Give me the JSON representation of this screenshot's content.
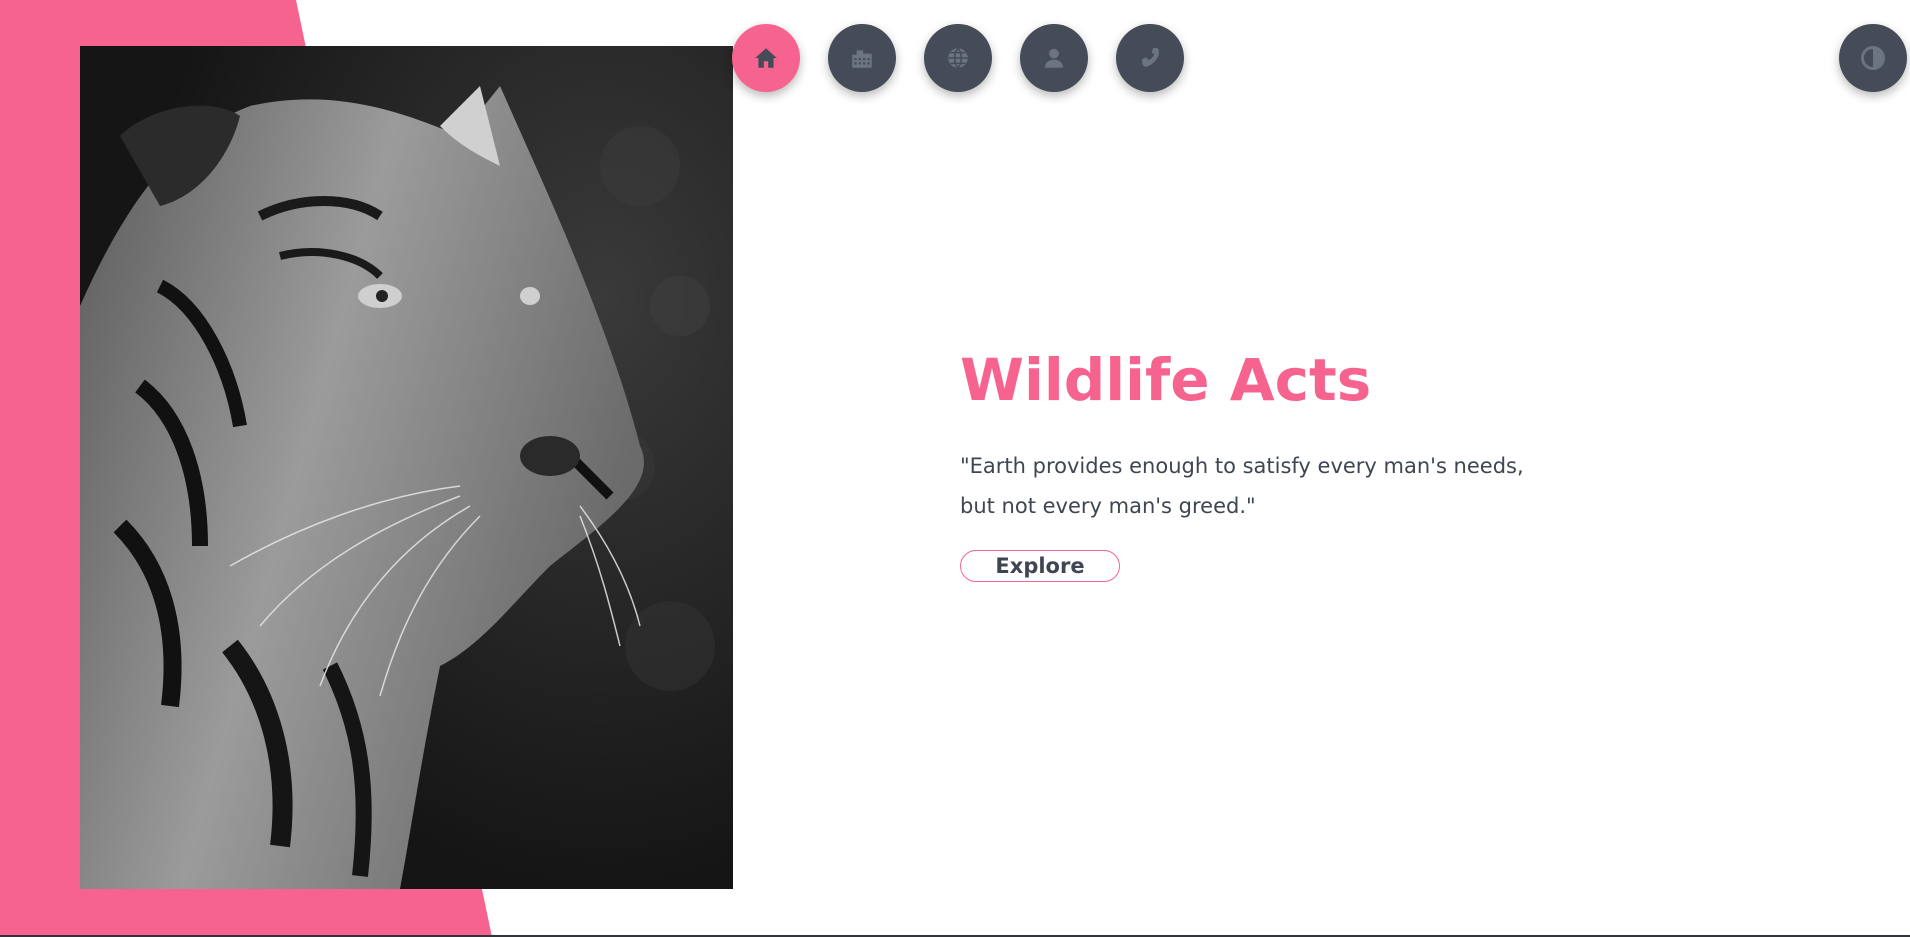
{
  "colors": {
    "accent": "#f7638f",
    "dark": "#454c57",
    "text": "#3f4652",
    "background": "#ffffff"
  },
  "nav": {
    "items": [
      {
        "icon": "home-icon",
        "active": true
      },
      {
        "icon": "building-icon",
        "active": false
      },
      {
        "icon": "globe-icon",
        "active": false
      },
      {
        "icon": "user-icon",
        "active": false
      },
      {
        "icon": "phone-icon",
        "active": false
      }
    ]
  },
  "theme_toggle": {
    "icon": "contrast-icon"
  },
  "hero": {
    "title": "Wildlife Acts",
    "quote_line1": "\"Earth provides enough to satisfy every man's needs,",
    "quote_line2": "but not every man's greed.\"",
    "button_label": "Explore",
    "image": "tiger-photo"
  }
}
